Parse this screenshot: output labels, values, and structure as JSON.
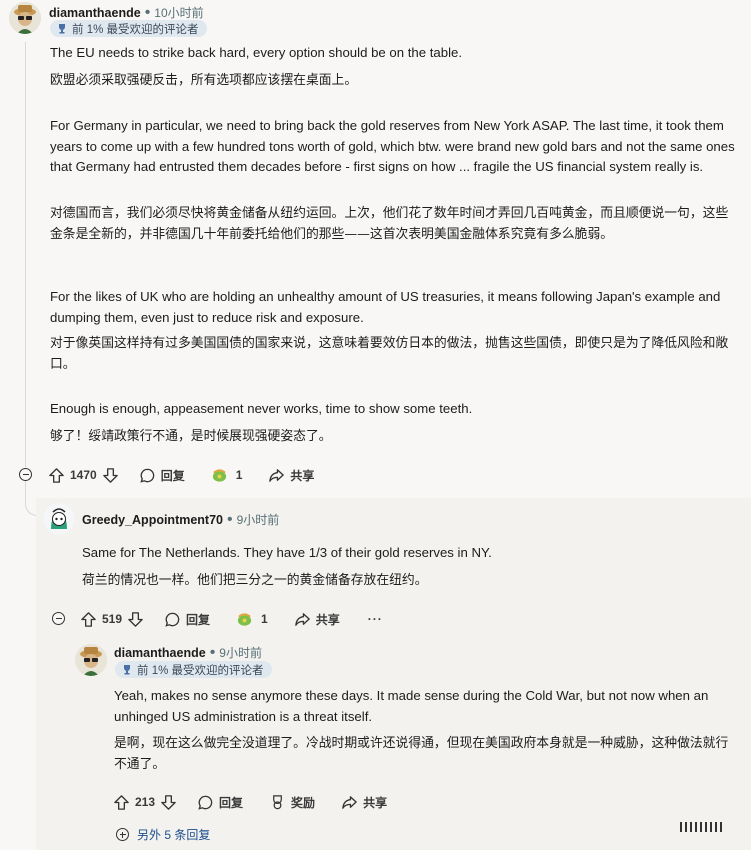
{
  "comment1": {
    "username": "diamanthaende",
    "time": "10小时前",
    "badge": "前 1% 最受欢迎的评论者",
    "paragraphs": [
      {
        "text": "The EU needs to strike back hard, every option should be on the table.",
        "lang": "en"
      },
      {
        "text": "欧盟必须采取强硬反击，所有选项都应该摆在桌面上。",
        "lang": "zh"
      },
      {
        "text": "For Germany in particular, we need to bring back the gold reserves from New York ASAP. The last time, it took them years to come up with a few hundred tons worth of gold, which btw. were brand new gold bars and not the same ones that Germany had entrusted them decades before - first signs on how ... fragile the US financial system really is.",
        "lang": "en"
      },
      {
        "text": "对德国而言，我们必须尽快将黄金储备从纽约运回。上次，他们花了数年时间才弄回几百吨黄金，而且顺便说一句，这些金条是全新的，并非德国几十年前委托给他们的那些——这首次表明美国金融体系究竟有多么脆弱。",
        "lang": "zh"
      },
      {
        "text": "For the likes of UK who are holding an unhealthy amount of US treasuries, it means following Japan's example and dumping them, even just to reduce risk and exposure.",
        "lang": "en"
      },
      {
        "text": "对于像英国这样持有过多美国国债的国家来说，这意味着要效仿日本的做法，抛售这些国债，即使只是为了降低风险和敞口。",
        "lang": "zh"
      },
      {
        "text": "Enough is enough, appeasement never works, time to show some teeth.",
        "lang": "en"
      },
      {
        "text": "够了！绥靖政策行不通，是时候展现强硬姿态了。",
        "lang": "zh"
      }
    ],
    "votes": "1470",
    "reply_label": "回复",
    "award_count": "1",
    "share_label": "共享"
  },
  "comment2": {
    "username": "Greedy_Appointment70",
    "time": "9小时前",
    "paragraphs": [
      {
        "text": "Same for The Netherlands. They have 1/3 of their gold reserves in NY.",
        "lang": "en"
      },
      {
        "text": "荷兰的情况也一样。他们把三分之一的黄金储备存放在纽约。",
        "lang": "zh"
      }
    ],
    "votes": "519",
    "reply_label": "回复",
    "award_count": "1",
    "share_label": "共享",
    "more_label": "···"
  },
  "comment3": {
    "username": "diamanthaende",
    "time": "9小时前",
    "badge": "前 1% 最受欢迎的评论者",
    "paragraphs": [
      {
        "text": "Yeah, makes no sense anymore these days. It made sense during the Cold War, but not now when an unhinged US administration is a threat itself.",
        "lang": "en"
      },
      {
        "text": "是啊，现在这么做完全没道理了。冷战时期或许还说得通，但现在美国政府本身就是一种威胁，这种做法就行不通了。",
        "lang": "zh"
      }
    ],
    "votes": "213",
    "reply_label": "回复",
    "award_label": "奖励",
    "share_label": "共享"
  },
  "more_replies": "另外 5 条回复",
  "colors": {
    "background": "#f8f7f5",
    "reply_panel": "#f3f2ef",
    "meta_text": "#576f76",
    "badge_bg": "#dfe7ef",
    "link": "#1c4e8c"
  }
}
